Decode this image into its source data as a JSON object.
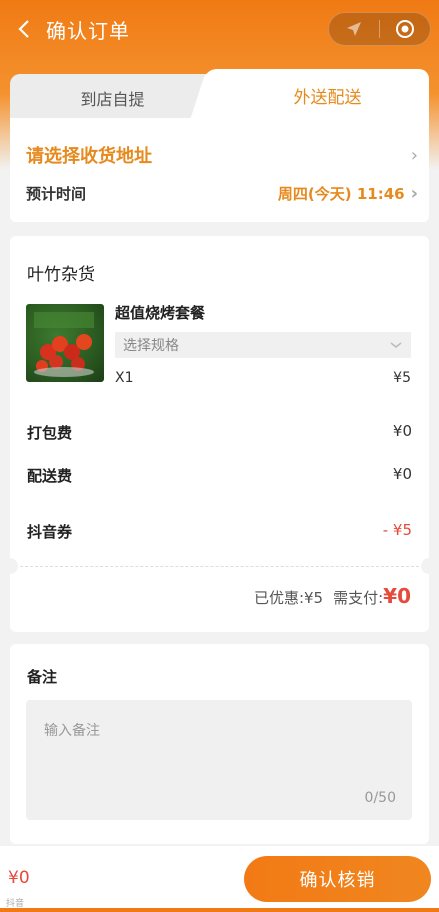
{
  "nav": {
    "title": "确认订单"
  },
  "tabs": [
    {
      "label": "到店自提",
      "active": false
    },
    {
      "label": "外送配送",
      "active": true
    }
  ],
  "address": {
    "label": "请选择收货地址",
    "time_label": "预计时间",
    "time_value": "周四(今天) 11:46"
  },
  "order": {
    "store_name": "叶竹杂货",
    "product": {
      "name": "超值烧烤套餐",
      "spec_placeholder": "选择规格",
      "qty": "X1",
      "price": "¥5"
    },
    "fees": [
      {
        "label": "打包费",
        "value": "¥0"
      },
      {
        "label": "配送费",
        "value": "¥0"
      },
      {
        "label": "抖音券",
        "value": "- ¥5"
      }
    ],
    "discount_label": "已优惠:",
    "discount_value": "¥5",
    "pay_label": "需支付:",
    "pay_value": "¥0"
  },
  "note": {
    "title": "备注",
    "placeholder": "输入备注",
    "count": "0/50"
  },
  "bottom": {
    "total": "¥0",
    "watermark": "抖音",
    "confirm_label": "确认核销"
  },
  "colors": {
    "accent": "#f07a14",
    "price_red": "#e64a3a",
    "link_orange": "#e68a1e"
  }
}
